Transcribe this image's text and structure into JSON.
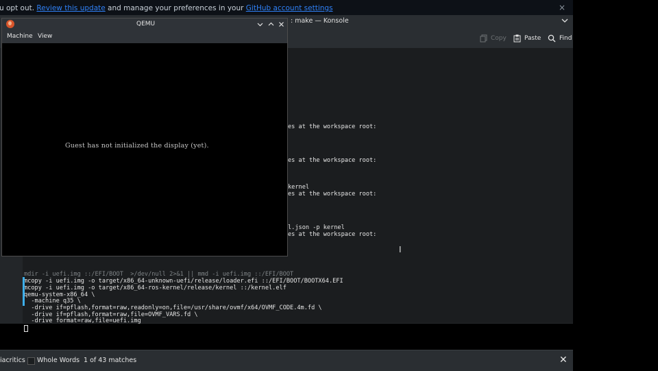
{
  "banner": {
    "prefix": "u opt out.",
    "link1": "Review this update",
    "middle": " and manage your preferences in your ",
    "link2": "GitHub account settings",
    "close_glyph": "×"
  },
  "konsole": {
    "title": ": make — Konsole",
    "toolbar": {
      "copy": "Copy",
      "paste": "Paste",
      "find": "Find"
    },
    "terminal_lines": [
      "es at the workspace root:",
      "es at the workspace root:",
      "kernel",
      "es at the workspace root:",
      "l.json -p kernel",
      "es at the workspace root:",
      "mdir -i uefi.img ::/EFI/BOOT  >/dev/null 2>&1 || mmd -i uefi.img ::/EFI/BOOT",
      "mcopy -i uefi.img -o target/x86_64-unknown-uefi/release/loader.efi ::/EFI/BOOT/BOOTX64.EFI",
      "mcopy -i uefi.img -o target/x86_64-ros-kernel/release/kernel ::/kernel.elf",
      "qemu-system-x86_64 \\",
      "  -machine q35 \\",
      "  -drive if=pflash,format=raw,readonly=on,file=/usr/share/ovmf/x64/OVMF_CODE.4m.fd \\",
      "  -drive if=pflash,format=raw,file=OVMF_VARS.fd \\",
      "  -drive format=raw,file=uefi.img"
    ]
  },
  "findbar": {
    "diacritics": "iacritics",
    "whole_words": "Whole Words",
    "matches": "1 of 43 matches",
    "close_glyph": "✕"
  },
  "qemu": {
    "title": "QEMU",
    "menu": [
      "Machine",
      "View"
    ],
    "message": "Guest has not initialized the display (yet)."
  }
}
